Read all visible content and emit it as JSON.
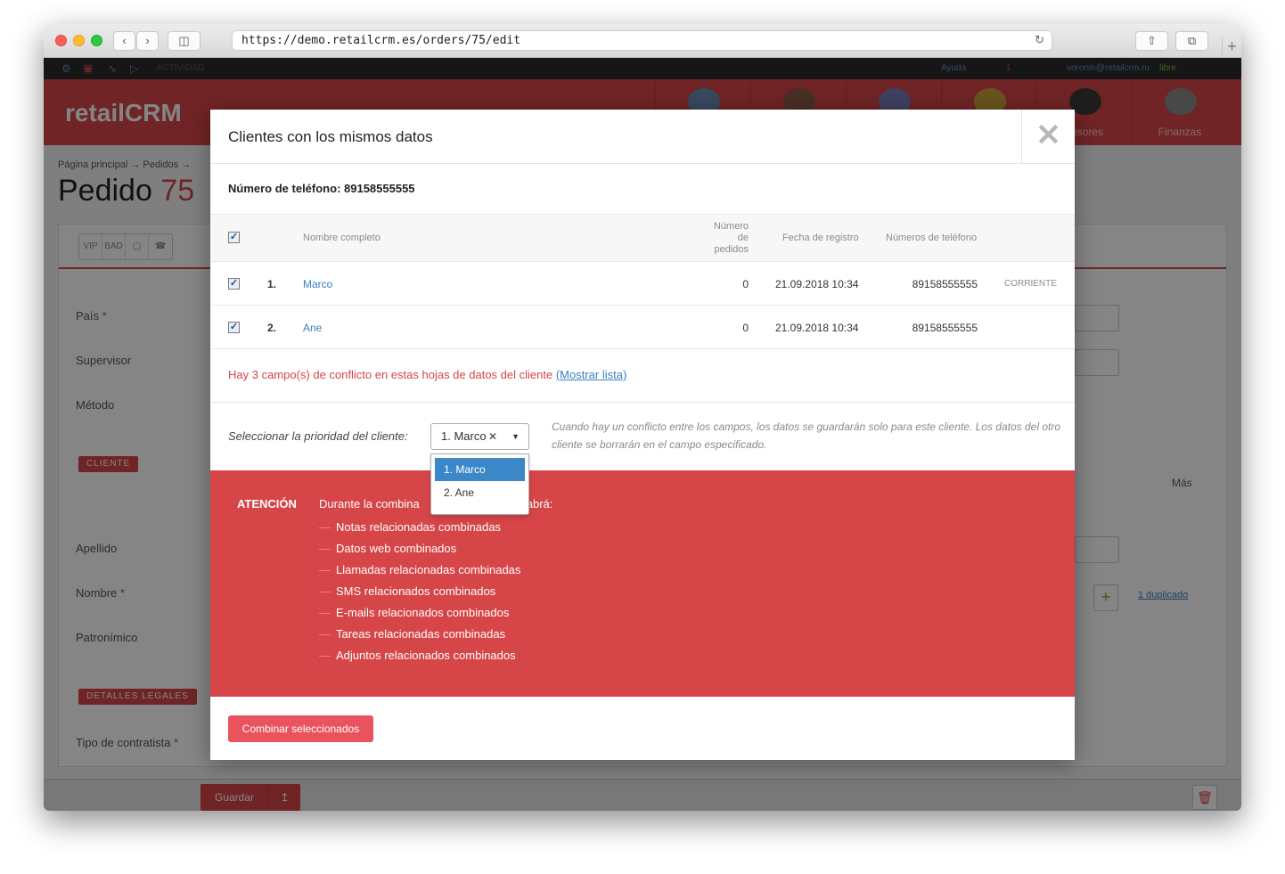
{
  "browser": {
    "url": "https://demo.retailcrm.es/orders/75/edit",
    "back_icon": "chevron-left-icon",
    "forward_icon": "chevron-right-icon"
  },
  "app": {
    "toolbar_activity": "ACTIVIDAD",
    "help": "Ayuda",
    "notif_count": "1",
    "user_email": "voronin@retailcrm.ru",
    "user_status": "libre",
    "logo": "retailCRM",
    "nav": [
      {
        "label": ""
      },
      {
        "label": ""
      },
      {
        "label": ""
      },
      {
        "label": ""
      },
      {
        "label": "rvisores"
      },
      {
        "label": "Finanzas"
      }
    ]
  },
  "page": {
    "breadcrumb": "Página principal → Pedidos →",
    "title_prefix": "Pedido",
    "title_number": "75",
    "tags": [
      "VIP",
      "BAD"
    ],
    "labels": {
      "pais": "País",
      "supervisor": "Supervisor",
      "metodo": "Método",
      "apellido": "Apellido",
      "nombre": "Nombre",
      "patronimico": "Patronímico",
      "tipo": "Tipo de contratista"
    },
    "sections": {
      "cliente": "CLIENTE",
      "legal": "DETALLES LEGALES"
    },
    "mas": "Más",
    "duplicado": "1 duplicado",
    "save": "Guardar"
  },
  "modal": {
    "title": "Clientes con los mismos datos",
    "phone_label": "Número de teléfono: 89158555555",
    "columns": {
      "name": "Nombre completo",
      "orders": "Número de pedidos",
      "reg": "Fecha de registro",
      "phones": "Números de teléfono"
    },
    "rows": [
      {
        "num": "1.",
        "name": "Marco",
        "orders": "0",
        "date": "21.09.2018 10:34",
        "phone": "89158555555",
        "tag": "CORRIENTE"
      },
      {
        "num": "2.",
        "name": "Ane",
        "orders": "0",
        "date": "21.09.2018 10:34",
        "phone": "89158555555",
        "tag": ""
      }
    ],
    "conflict_text": "Hay 3 campo(s) de conflicto en estas hojas de datos del cliente",
    "conflict_link": "(Mostrar lista)",
    "priority_label": "Seleccionar la prioridad del cliente:",
    "priority_value": "1. Marco",
    "priority_hint": "Cuando hay un conflicto entre los campos, los datos se guardarán solo para este cliente. Los datos del otro cliente se borrarán en el campo especificado.",
    "dropdown_options": [
      "1. Marco",
      "2. Ane"
    ],
    "warning_head": "ATENCIÓN",
    "warning_intro_left": "Durante la combina",
    "warning_intro_right": "abrá:",
    "warning_items": [
      "Notas relacionadas combinadas",
      "Datos web combinados",
      "Llamadas relacionadas combinadas",
      "SMS relacionados combinados",
      "E-mails relacionados combinados",
      "Tareas relacionadas combinadas",
      "Adjuntos relacionados combinados"
    ],
    "combine_button": "Combinar seleccionados"
  },
  "colors": {
    "brand_red": "#d64548",
    "link_blue": "#3a7fc5",
    "select_blue": "#3b87c7"
  }
}
